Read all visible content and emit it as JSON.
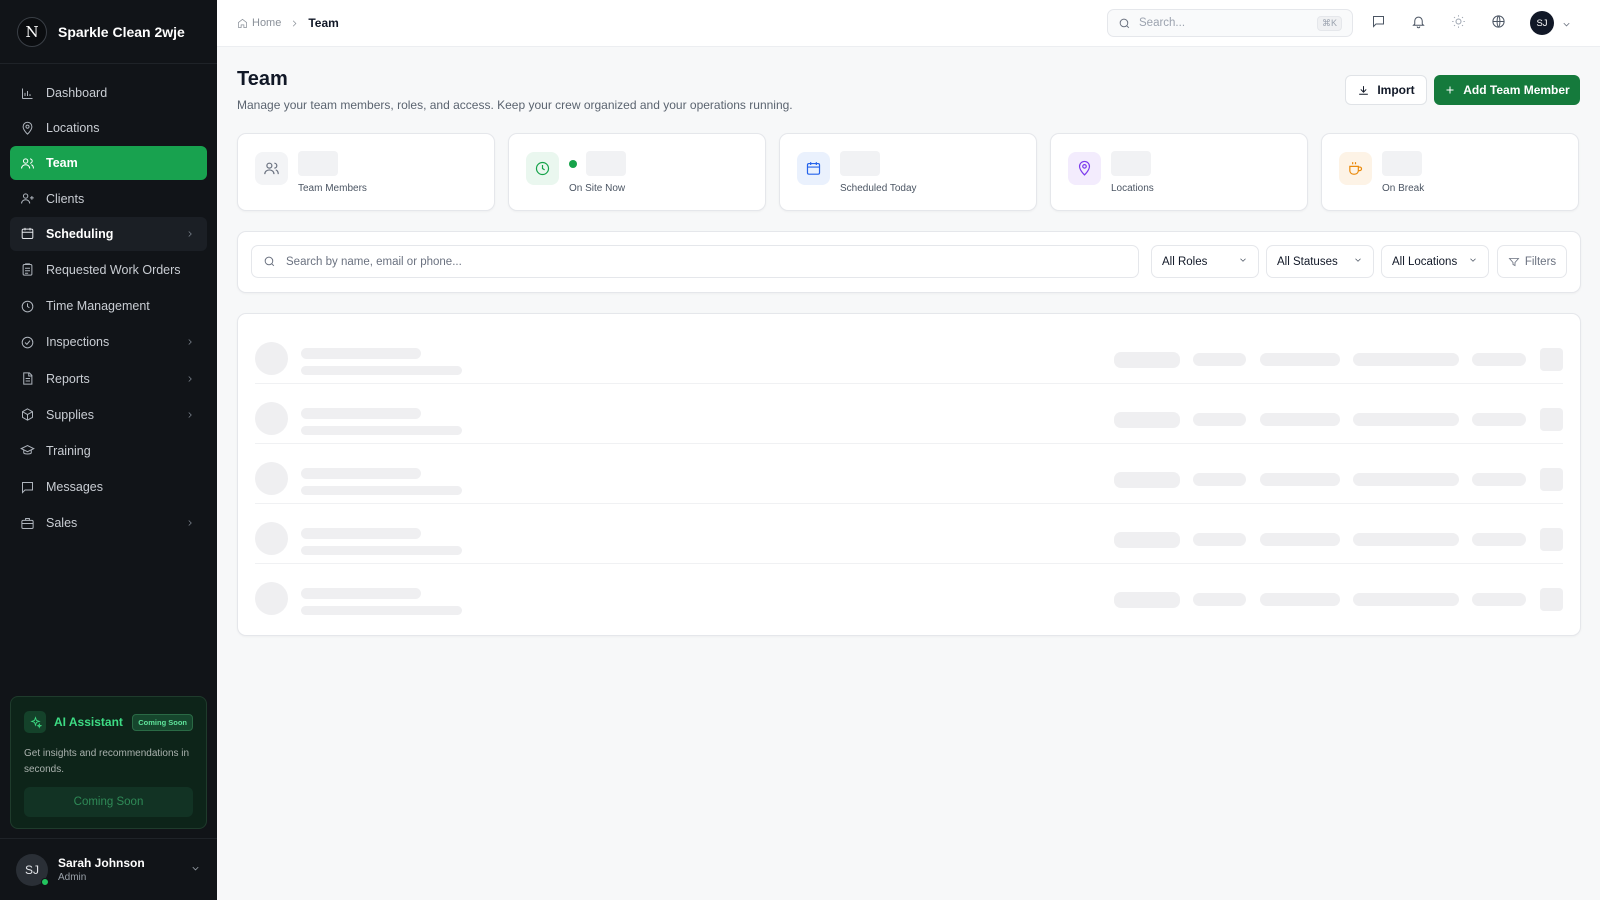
{
  "brand": {
    "logo_letter": "N",
    "name": "Sparkle Clean 2wje"
  },
  "sidebar": {
    "items": [
      {
        "label": "Dashboard",
        "icon": "bar-chart-icon",
        "state": "normal",
        "has_chevron": false
      },
      {
        "label": "Locations",
        "icon": "map-pin-icon",
        "state": "normal",
        "has_chevron": false
      },
      {
        "label": "Team",
        "icon": "users-icon",
        "state": "active",
        "has_chevron": false
      },
      {
        "label": "Clients",
        "icon": "user-plus-icon",
        "state": "normal",
        "has_chevron": false
      },
      {
        "label": "Scheduling",
        "icon": "calendar-icon",
        "state": "hover",
        "has_chevron": true
      },
      {
        "label": "Requested Work Orders",
        "icon": "clipboard-icon",
        "state": "normal",
        "has_chevron": false
      },
      {
        "label": "Time Management",
        "icon": "clock-icon",
        "state": "normal",
        "has_chevron": false
      },
      {
        "label": "Inspections",
        "icon": "check-circle-icon",
        "state": "normal",
        "has_chevron": true
      },
      {
        "label": "Reports",
        "icon": "file-text-icon",
        "state": "normal",
        "has_chevron": true
      },
      {
        "label": "Supplies",
        "icon": "package-icon",
        "state": "normal",
        "has_chevron": true
      },
      {
        "label": "Training",
        "icon": "graduation-cap-icon",
        "state": "normal",
        "has_chevron": false
      },
      {
        "label": "Messages",
        "icon": "message-square-icon",
        "state": "normal",
        "has_chevron": false
      },
      {
        "label": "Sales",
        "icon": "briefcase-icon",
        "state": "normal",
        "has_chevron": true
      }
    ],
    "ai": {
      "title": "AI Assistant",
      "badge": "Coming Soon",
      "description": "Get insights and recommendations in seconds.",
      "button": "Coming Soon"
    },
    "user": {
      "initials": "SJ",
      "name": "Sarah Johnson",
      "role": "Admin",
      "status_color": "#22c55e"
    }
  },
  "topbar": {
    "breadcrumb": {
      "home": "Home",
      "current": "Team"
    },
    "search_placeholder": "Search...",
    "shortcut": "⌘K",
    "avatar_initials": "SJ"
  },
  "main": {
    "title": "Team",
    "subtitle": "Manage your team members, roles, and access. Keep your crew organized and your operations running.",
    "import_label": "Import",
    "add_label": "Add Team Member",
    "stats": [
      {
        "label": "Team Members",
        "icon": "users-icon",
        "accent": "#6b7280",
        "bg": "#f3f4f6",
        "dot": false
      },
      {
        "label": "On Site Now",
        "icon": "clock-icon",
        "accent": "#16a34a",
        "bg": "#eaf7ef",
        "dot": true
      },
      {
        "label": "Scheduled Today",
        "icon": "calendar-icon",
        "accent": "#2563eb",
        "bg": "#eaf1fd",
        "dot": false
      },
      {
        "label": "Locations",
        "icon": "map-pin-icon",
        "accent": "#7c3aed",
        "bg": "#f3ecfd",
        "dot": false
      },
      {
        "label": "On Break",
        "icon": "coffee-icon",
        "accent": "#ea8a0c",
        "bg": "#fdf3e6",
        "dot": false
      }
    ],
    "filters": {
      "search_placeholder": "Search by name, email or phone...",
      "roles": "All Roles",
      "statuses": "All Statuses",
      "locations": "All Locations",
      "filters_label": "Filters"
    },
    "loading_rows": 5
  },
  "colors": {
    "brand_green": "#157a3c",
    "active_green": "#18a24f",
    "sidebar_bg": "#111418"
  }
}
